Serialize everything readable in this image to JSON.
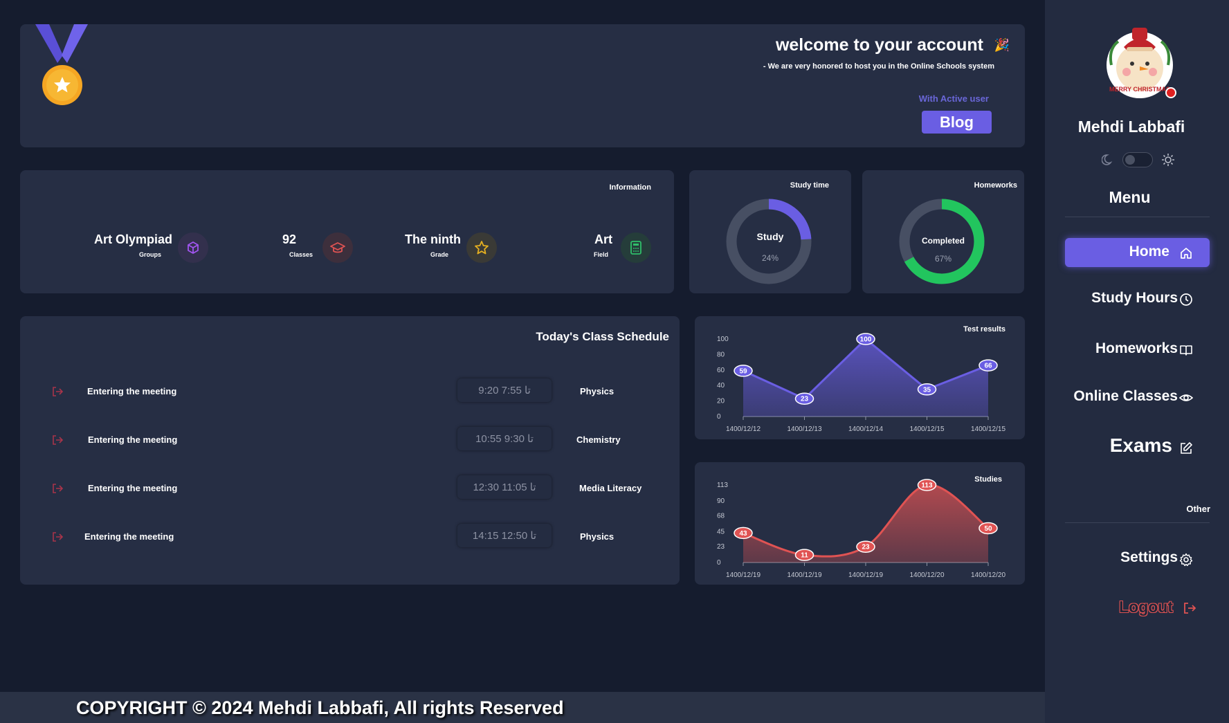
{
  "welcome": {
    "title": "welcome to your account",
    "subtitle": "- We are very honored to host you in the Online Schools system",
    "active_user_label": "With Active user",
    "blog_label": "Blog"
  },
  "info": {
    "title": "Information",
    "items": [
      {
        "value": "Art Olympiad",
        "label": "Groups",
        "icon": "cube-icon",
        "color": "#8a4fe0"
      },
      {
        "value": "92",
        "label": "Classes",
        "icon": "graduation-cap-icon",
        "color": "#e05353"
      },
      {
        "value": "The ninth",
        "label": "Grade",
        "icon": "star-icon",
        "color": "#e6b020"
      },
      {
        "value": "Art",
        "label": "Field",
        "icon": "calculator-icon",
        "color": "#2fbf6a"
      }
    ]
  },
  "study_time": {
    "title": "Study time",
    "label": "Study",
    "percent_text": "24%",
    "percent": 24,
    "color": "#6a5ee3"
  },
  "homeworks": {
    "title": "Homeworks",
    "label": "Completed",
    "percent_text": "67%",
    "percent": 67,
    "color": "#22c55e"
  },
  "schedule": {
    "title": "Today's Class Schedule",
    "rows": [
      {
        "action": "Entering the meeting",
        "time": "9:20 تا 7:55",
        "subject": "Physics"
      },
      {
        "action": "Entering the meeting",
        "time": "10:55 تا 9:30",
        "subject": "Chemistry"
      },
      {
        "action": "Entering the meeting",
        "time": "12:30 تا 11:05",
        "subject": "Media Literacy"
      },
      {
        "action": "Entering the meeting",
        "time": "14:15 تا 12:50",
        "subject": "Physics"
      }
    ]
  },
  "chart_data": [
    {
      "type": "area",
      "title": "Test results",
      "categories": [
        "1400/12/12",
        "1400/12/13",
        "1400/12/14",
        "1400/12/15",
        "1400/12/15"
      ],
      "values": [
        59,
        23,
        100,
        35,
        66
      ],
      "yticks": [
        0,
        20,
        40,
        60,
        80,
        100
      ],
      "ylim": [
        0,
        100
      ],
      "color": "#6a5ee3",
      "curve": "straight"
    },
    {
      "type": "area",
      "title": "Studies",
      "categories": [
        "1400/12/19",
        "1400/12/19",
        "1400/12/19",
        "1400/12/20",
        "1400/12/20"
      ],
      "values": [
        43,
        11,
        23,
        113,
        50
      ],
      "yticks": [
        0,
        23,
        45,
        68,
        90,
        113
      ],
      "ylim": [
        0,
        113
      ],
      "color": "#e05353",
      "curve": "smooth"
    }
  ],
  "sidebar": {
    "name": "Mehdi Labbafi",
    "menu_title": "Menu",
    "other_label": "Other",
    "items": [
      {
        "label": "Home",
        "icon": "home-icon"
      },
      {
        "label": "Study Hours",
        "icon": "clock-icon"
      },
      {
        "label": "Homeworks",
        "icon": "book-icon"
      },
      {
        "label": "Online Classes",
        "icon": "eye-icon"
      },
      {
        "label": "Exams",
        "icon": "edit-icon"
      },
      {
        "label": "Settings",
        "icon": "gear-icon"
      },
      {
        "label": "Logout",
        "icon": "logout-icon"
      }
    ],
    "avatar_text": "MERRY CHRISTMAS"
  },
  "footer": {
    "text": "COPYRIGHT © 2024 Mehdi Labbafi, All rights Reserved"
  },
  "colors": {
    "accent": "#6a5ee3",
    "danger": "#e05353",
    "success": "#22c55e",
    "background": "#151c2e",
    "card": "#262e44"
  }
}
